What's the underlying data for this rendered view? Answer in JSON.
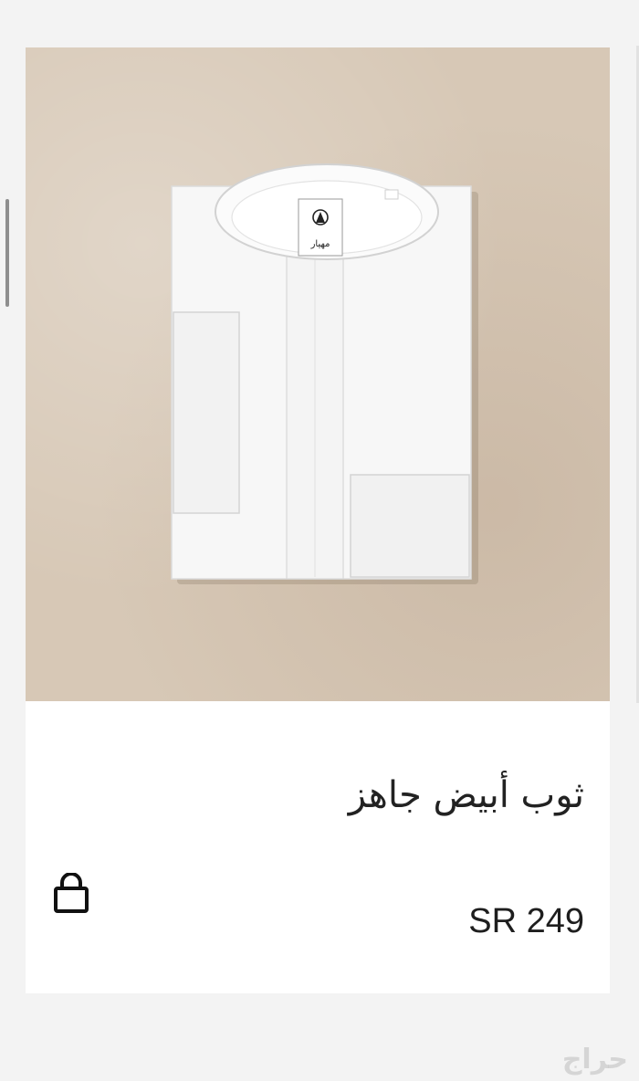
{
  "product": {
    "title": "ثوب أبيض جاهز",
    "price": "SR 249",
    "image_label_text": "مهيار"
  },
  "actions": {
    "bag_icon": "shopping-bag-icon"
  },
  "watermark": {
    "text": "حراج"
  },
  "colors": {
    "background": "#f3f3f3",
    "card": "#ffffff",
    "image_backdrop": "#d7c8b6",
    "text": "#222222"
  }
}
